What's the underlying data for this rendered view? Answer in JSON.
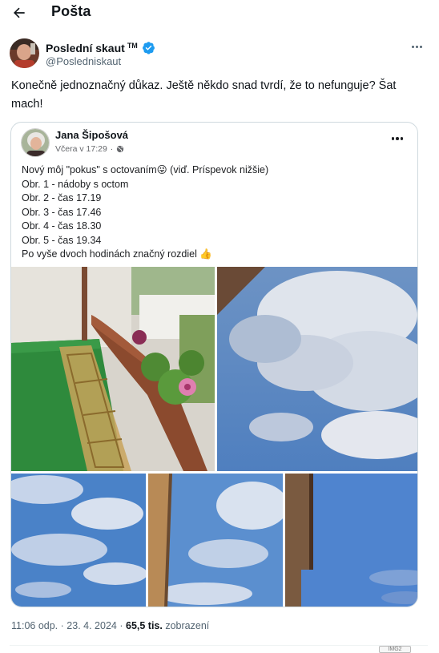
{
  "header": {
    "title": "Pošta",
    "back_icon": "arrow-left-icon"
  },
  "post": {
    "author_name": "Poslední skaut",
    "author_tm": "TM",
    "author_handle": "@Posledniskaut",
    "verified_color": "#1d9bf0",
    "text": "Konečně jednoznačný důkaz. Ještě někdo snad tvrdí, že to nefunguje? Šat mach!",
    "time": "11:06 odp.",
    "separator": "·",
    "date": "23. 4. 2024",
    "separator2": "·",
    "views_count": "65,5 tis.",
    "views_label": "zobrazení"
  },
  "embedded": {
    "author_name": "Jana Šipošová",
    "meta_time": "Včera v 17:29",
    "meta_sep": "·",
    "lines": [
      "Nový môj \"pokus\" s octovaním😜 (viď. Príspevok nižšie)",
      "Obr. 1 - nádoby s octom",
      "Obr. 2 - čas 17.19",
      "Obr. 3 - čas 17.46",
      "Obr. 4 - čas 18.30",
      "Obr. 5 - čas 19.34",
      "Po vyše dvoch hodinách značný rozdiel 👍"
    ]
  },
  "badge": {
    "label": "IMG2"
  },
  "colors": {
    "text": "#0f1419",
    "secondary": "#536471",
    "border": "#cfd9de"
  }
}
